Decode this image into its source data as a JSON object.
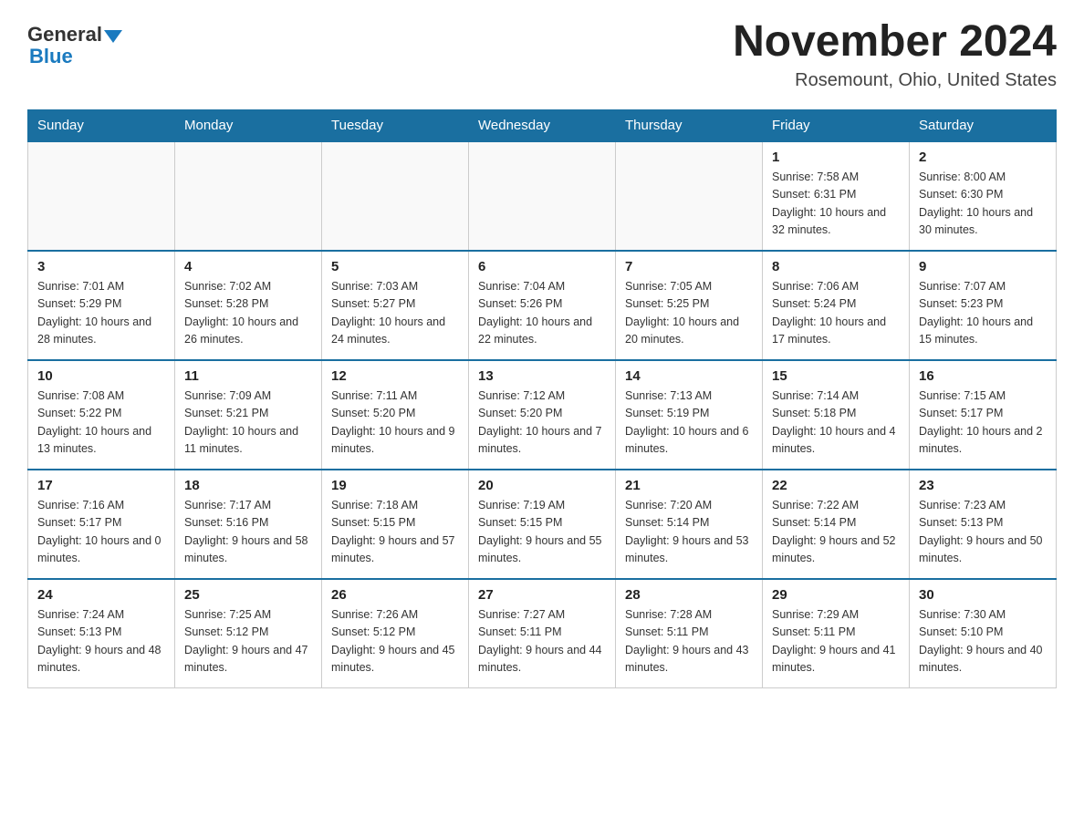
{
  "header": {
    "logo_general": "General",
    "logo_blue": "Blue",
    "month_title": "November 2024",
    "location": "Rosemount, Ohio, United States"
  },
  "days_of_week": [
    "Sunday",
    "Monday",
    "Tuesday",
    "Wednesday",
    "Thursday",
    "Friday",
    "Saturday"
  ],
  "weeks": [
    [
      {
        "day": "",
        "sunrise": "",
        "sunset": "",
        "daylight": ""
      },
      {
        "day": "",
        "sunrise": "",
        "sunset": "",
        "daylight": ""
      },
      {
        "day": "",
        "sunrise": "",
        "sunset": "",
        "daylight": ""
      },
      {
        "day": "",
        "sunrise": "",
        "sunset": "",
        "daylight": ""
      },
      {
        "day": "",
        "sunrise": "",
        "sunset": "",
        "daylight": ""
      },
      {
        "day": "1",
        "sunrise": "Sunrise: 7:58 AM",
        "sunset": "Sunset: 6:31 PM",
        "daylight": "Daylight: 10 hours and 32 minutes."
      },
      {
        "day": "2",
        "sunrise": "Sunrise: 8:00 AM",
        "sunset": "Sunset: 6:30 PM",
        "daylight": "Daylight: 10 hours and 30 minutes."
      }
    ],
    [
      {
        "day": "3",
        "sunrise": "Sunrise: 7:01 AM",
        "sunset": "Sunset: 5:29 PM",
        "daylight": "Daylight: 10 hours and 28 minutes."
      },
      {
        "day": "4",
        "sunrise": "Sunrise: 7:02 AM",
        "sunset": "Sunset: 5:28 PM",
        "daylight": "Daylight: 10 hours and 26 minutes."
      },
      {
        "day": "5",
        "sunrise": "Sunrise: 7:03 AM",
        "sunset": "Sunset: 5:27 PM",
        "daylight": "Daylight: 10 hours and 24 minutes."
      },
      {
        "day": "6",
        "sunrise": "Sunrise: 7:04 AM",
        "sunset": "Sunset: 5:26 PM",
        "daylight": "Daylight: 10 hours and 22 minutes."
      },
      {
        "day": "7",
        "sunrise": "Sunrise: 7:05 AM",
        "sunset": "Sunset: 5:25 PM",
        "daylight": "Daylight: 10 hours and 20 minutes."
      },
      {
        "day": "8",
        "sunrise": "Sunrise: 7:06 AM",
        "sunset": "Sunset: 5:24 PM",
        "daylight": "Daylight: 10 hours and 17 minutes."
      },
      {
        "day": "9",
        "sunrise": "Sunrise: 7:07 AM",
        "sunset": "Sunset: 5:23 PM",
        "daylight": "Daylight: 10 hours and 15 minutes."
      }
    ],
    [
      {
        "day": "10",
        "sunrise": "Sunrise: 7:08 AM",
        "sunset": "Sunset: 5:22 PM",
        "daylight": "Daylight: 10 hours and 13 minutes."
      },
      {
        "day": "11",
        "sunrise": "Sunrise: 7:09 AM",
        "sunset": "Sunset: 5:21 PM",
        "daylight": "Daylight: 10 hours and 11 minutes."
      },
      {
        "day": "12",
        "sunrise": "Sunrise: 7:11 AM",
        "sunset": "Sunset: 5:20 PM",
        "daylight": "Daylight: 10 hours and 9 minutes."
      },
      {
        "day": "13",
        "sunrise": "Sunrise: 7:12 AM",
        "sunset": "Sunset: 5:20 PM",
        "daylight": "Daylight: 10 hours and 7 minutes."
      },
      {
        "day": "14",
        "sunrise": "Sunrise: 7:13 AM",
        "sunset": "Sunset: 5:19 PM",
        "daylight": "Daylight: 10 hours and 6 minutes."
      },
      {
        "day": "15",
        "sunrise": "Sunrise: 7:14 AM",
        "sunset": "Sunset: 5:18 PM",
        "daylight": "Daylight: 10 hours and 4 minutes."
      },
      {
        "day": "16",
        "sunrise": "Sunrise: 7:15 AM",
        "sunset": "Sunset: 5:17 PM",
        "daylight": "Daylight: 10 hours and 2 minutes."
      }
    ],
    [
      {
        "day": "17",
        "sunrise": "Sunrise: 7:16 AM",
        "sunset": "Sunset: 5:17 PM",
        "daylight": "Daylight: 10 hours and 0 minutes."
      },
      {
        "day": "18",
        "sunrise": "Sunrise: 7:17 AM",
        "sunset": "Sunset: 5:16 PM",
        "daylight": "Daylight: 9 hours and 58 minutes."
      },
      {
        "day": "19",
        "sunrise": "Sunrise: 7:18 AM",
        "sunset": "Sunset: 5:15 PM",
        "daylight": "Daylight: 9 hours and 57 minutes."
      },
      {
        "day": "20",
        "sunrise": "Sunrise: 7:19 AM",
        "sunset": "Sunset: 5:15 PM",
        "daylight": "Daylight: 9 hours and 55 minutes."
      },
      {
        "day": "21",
        "sunrise": "Sunrise: 7:20 AM",
        "sunset": "Sunset: 5:14 PM",
        "daylight": "Daylight: 9 hours and 53 minutes."
      },
      {
        "day": "22",
        "sunrise": "Sunrise: 7:22 AM",
        "sunset": "Sunset: 5:14 PM",
        "daylight": "Daylight: 9 hours and 52 minutes."
      },
      {
        "day": "23",
        "sunrise": "Sunrise: 7:23 AM",
        "sunset": "Sunset: 5:13 PM",
        "daylight": "Daylight: 9 hours and 50 minutes."
      }
    ],
    [
      {
        "day": "24",
        "sunrise": "Sunrise: 7:24 AM",
        "sunset": "Sunset: 5:13 PM",
        "daylight": "Daylight: 9 hours and 48 minutes."
      },
      {
        "day": "25",
        "sunrise": "Sunrise: 7:25 AM",
        "sunset": "Sunset: 5:12 PM",
        "daylight": "Daylight: 9 hours and 47 minutes."
      },
      {
        "day": "26",
        "sunrise": "Sunrise: 7:26 AM",
        "sunset": "Sunset: 5:12 PM",
        "daylight": "Daylight: 9 hours and 45 minutes."
      },
      {
        "day": "27",
        "sunrise": "Sunrise: 7:27 AM",
        "sunset": "Sunset: 5:11 PM",
        "daylight": "Daylight: 9 hours and 44 minutes."
      },
      {
        "day": "28",
        "sunrise": "Sunrise: 7:28 AM",
        "sunset": "Sunset: 5:11 PM",
        "daylight": "Daylight: 9 hours and 43 minutes."
      },
      {
        "day": "29",
        "sunrise": "Sunrise: 7:29 AM",
        "sunset": "Sunset: 5:11 PM",
        "daylight": "Daylight: 9 hours and 41 minutes."
      },
      {
        "day": "30",
        "sunrise": "Sunrise: 7:30 AM",
        "sunset": "Sunset: 5:10 PM",
        "daylight": "Daylight: 9 hours and 40 minutes."
      }
    ]
  ]
}
